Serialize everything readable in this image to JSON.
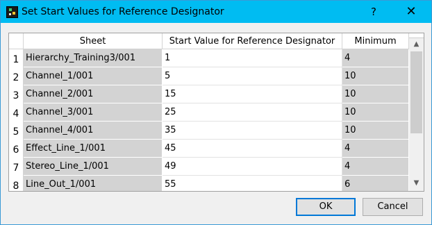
{
  "window": {
    "title": "Set Start Values for Reference Designator",
    "help_label": "?",
    "close_label": "✕"
  },
  "table": {
    "headers": [
      "Sheet",
      "Start Value for Reference Designator",
      "Minimum"
    ],
    "rows": [
      {
        "num": "1",
        "sheet": "Hierarchy_Training3/001",
        "start": "1",
        "min": "4"
      },
      {
        "num": "2",
        "sheet": "Channel_1/001",
        "start": "5",
        "min": "10"
      },
      {
        "num": "3",
        "sheet": "Channel_2/001",
        "start": "15",
        "min": "10"
      },
      {
        "num": "4",
        "sheet": "Channel_3/001",
        "start": "25",
        "min": "10"
      },
      {
        "num": "5",
        "sheet": "Channel_4/001",
        "start": "35",
        "min": "10"
      },
      {
        "num": "6",
        "sheet": "Effect_Line_1/001",
        "start": "45",
        "min": "4"
      },
      {
        "num": "7",
        "sheet": "Stereo_Line_1/001",
        "start": "49",
        "min": "4"
      },
      {
        "num": "8",
        "sheet": "Line_Out_1/001",
        "start": "55",
        "min": "6"
      }
    ]
  },
  "scrollbar": {
    "up_glyph": "▲",
    "down_glyph": "▼"
  },
  "buttons": {
    "ok_label": "OK",
    "cancel_label": "Cancel"
  },
  "colors": {
    "titlebar": "#00bcf2",
    "readonly_cell": "#d3d3d3",
    "ok_border": "#0078d7"
  }
}
